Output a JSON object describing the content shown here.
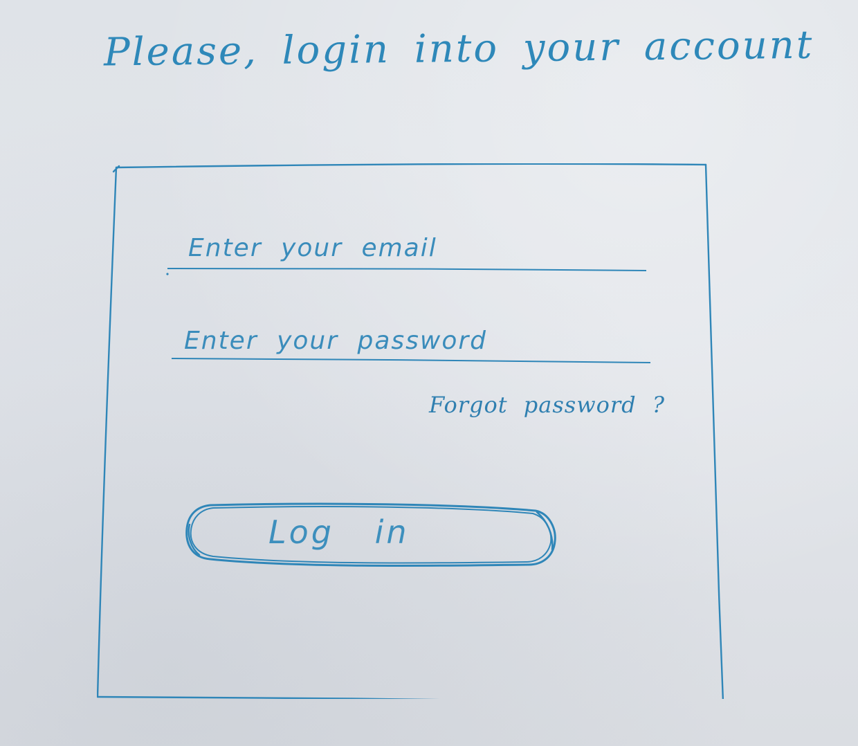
{
  "page": {
    "title": "Please, login into your account"
  },
  "login_form": {
    "email_placeholder": "Enter your email",
    "password_placeholder": "Enter your password",
    "forgot_password_label": "Forgot password ?",
    "login_button_label": "Log in"
  },
  "colors": {
    "ink": "#2f86b8",
    "paper": "#e0e3e8"
  }
}
